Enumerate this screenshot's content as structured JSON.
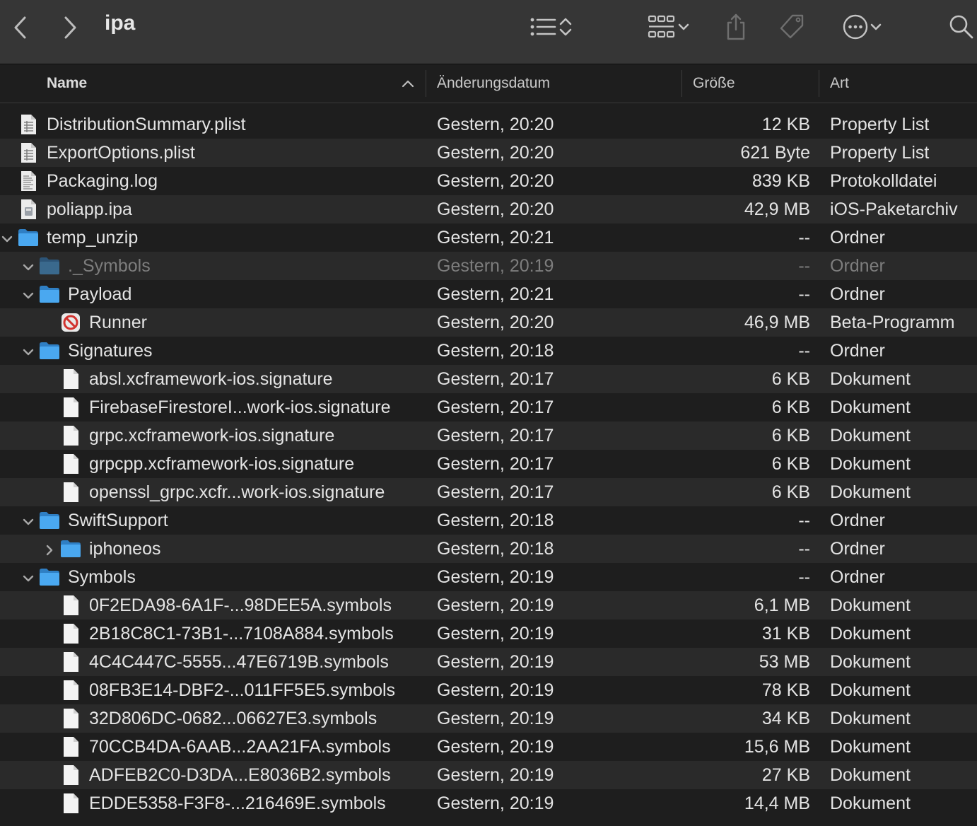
{
  "window": {
    "title": "ipa"
  },
  "colors": {
    "folder": "#4aa8f0",
    "row_alt": "#2a2a2a",
    "background": "#1e1e1e",
    "toolbar": "#363636"
  },
  "toolbar": {
    "icons": [
      "chevron-left-icon",
      "chevron-right-icon",
      "list-view-icon",
      "sort-updown-icon",
      "group-icon",
      "chevron-down-icon",
      "share-icon",
      "tag-icon",
      "more-icon",
      "chevron-down-icon",
      "search-icon"
    ]
  },
  "columns": {
    "name": "Name",
    "date": "Änderungsdatum",
    "size": "Größe",
    "kind": "Art"
  },
  "rows": [
    {
      "name": "DistributionSummary.plist",
      "date": "Gestern, 20:20",
      "size": "12 KB",
      "kind": "Property List",
      "icon": "plist",
      "level": 0,
      "disclosure": "none"
    },
    {
      "name": "ExportOptions.plist",
      "date": "Gestern, 20:20",
      "size": "621 Byte",
      "kind": "Property List",
      "icon": "plist",
      "level": 0,
      "disclosure": "none"
    },
    {
      "name": "Packaging.log",
      "date": "Gestern, 20:20",
      "size": "839 KB",
      "kind": "Protokolldatei",
      "icon": "log",
      "level": 0,
      "disclosure": "none"
    },
    {
      "name": "poliapp.ipa",
      "date": "Gestern, 20:20",
      "size": "42,9 MB",
      "kind": "iOS-Paketarchiv",
      "icon": "ipa",
      "level": 0,
      "disclosure": "none"
    },
    {
      "name": "temp_unzip",
      "date": "Gestern, 20:21",
      "size": "--",
      "kind": "Ordner",
      "icon": "folder",
      "level": 0,
      "disclosure": "open"
    },
    {
      "name": "._Symbols",
      "date": "Gestern, 20:19",
      "size": "--",
      "kind": "Ordner",
      "icon": "folder",
      "level": 1,
      "disclosure": "open",
      "dim": true
    },
    {
      "name": "Payload",
      "date": "Gestern, 20:21",
      "size": "--",
      "kind": "Ordner",
      "icon": "folder",
      "level": 1,
      "disclosure": "open"
    },
    {
      "name": "Runner",
      "date": "Gestern, 20:20",
      "size": "46,9 MB",
      "kind": "Beta-Programm",
      "icon": "app-blocked",
      "level": 2,
      "disclosure": "none"
    },
    {
      "name": "Signatures",
      "date": "Gestern, 20:18",
      "size": "--",
      "kind": "Ordner",
      "icon": "folder",
      "level": 1,
      "disclosure": "open"
    },
    {
      "name": "absl.xcframework-ios.signature",
      "date": "Gestern, 20:17",
      "size": "6 KB",
      "kind": "Dokument",
      "icon": "doc",
      "level": 2,
      "disclosure": "none"
    },
    {
      "name": "FirebaseFirestoreI...work-ios.signature",
      "date": "Gestern, 20:17",
      "size": "6 KB",
      "kind": "Dokument",
      "icon": "doc",
      "level": 2,
      "disclosure": "none"
    },
    {
      "name": "grpc.xcframework-ios.signature",
      "date": "Gestern, 20:17",
      "size": "6 KB",
      "kind": "Dokument",
      "icon": "doc",
      "level": 2,
      "disclosure": "none"
    },
    {
      "name": "grpcpp.xcframework-ios.signature",
      "date": "Gestern, 20:17",
      "size": "6 KB",
      "kind": "Dokument",
      "icon": "doc",
      "level": 2,
      "disclosure": "none"
    },
    {
      "name": "openssl_grpc.xcfr...work-ios.signature",
      "date": "Gestern, 20:17",
      "size": "6 KB",
      "kind": "Dokument",
      "icon": "doc",
      "level": 2,
      "disclosure": "none"
    },
    {
      "name": "SwiftSupport",
      "date": "Gestern, 20:18",
      "size": "--",
      "kind": "Ordner",
      "icon": "folder",
      "level": 1,
      "disclosure": "open"
    },
    {
      "name": "iphoneos",
      "date": "Gestern, 20:18",
      "size": "--",
      "kind": "Ordner",
      "icon": "folder",
      "level": 2,
      "disclosure": "closed"
    },
    {
      "name": "Symbols",
      "date": "Gestern, 20:19",
      "size": "--",
      "kind": "Ordner",
      "icon": "folder",
      "level": 1,
      "disclosure": "open"
    },
    {
      "name": "0F2EDA98-6A1F-...98DEE5A.symbols",
      "date": "Gestern, 20:19",
      "size": "6,1 MB",
      "kind": "Dokument",
      "icon": "doc",
      "level": 2,
      "disclosure": "none"
    },
    {
      "name": "2B18C8C1-73B1-...7108A884.symbols",
      "date": "Gestern, 20:19",
      "size": "31 KB",
      "kind": "Dokument",
      "icon": "doc",
      "level": 2,
      "disclosure": "none"
    },
    {
      "name": "4C4C447C-5555...47E6719B.symbols",
      "date": "Gestern, 20:19",
      "size": "53 MB",
      "kind": "Dokument",
      "icon": "doc",
      "level": 2,
      "disclosure": "none"
    },
    {
      "name": "08FB3E14-DBF2-...011FF5E5.symbols",
      "date": "Gestern, 20:19",
      "size": "78 KB",
      "kind": "Dokument",
      "icon": "doc",
      "level": 2,
      "disclosure": "none"
    },
    {
      "name": "32D806DC-0682...06627E3.symbols",
      "date": "Gestern, 20:19",
      "size": "34 KB",
      "kind": "Dokument",
      "icon": "doc",
      "level": 2,
      "disclosure": "none"
    },
    {
      "name": "70CCB4DA-6AAB...2AA21FA.symbols",
      "date": "Gestern, 20:19",
      "size": "15,6 MB",
      "kind": "Dokument",
      "icon": "doc",
      "level": 2,
      "disclosure": "none"
    },
    {
      "name": "ADFEB2C0-D3DA...E8036B2.symbols",
      "date": "Gestern, 20:19",
      "size": "27 KB",
      "kind": "Dokument",
      "icon": "doc",
      "level": 2,
      "disclosure": "none"
    },
    {
      "name": "EDDE5358-F3F8-...216469E.symbols",
      "date": "Gestern, 20:19",
      "size": "14,4 MB",
      "kind": "Dokument",
      "icon": "doc",
      "level": 2,
      "disclosure": "none"
    }
  ]
}
